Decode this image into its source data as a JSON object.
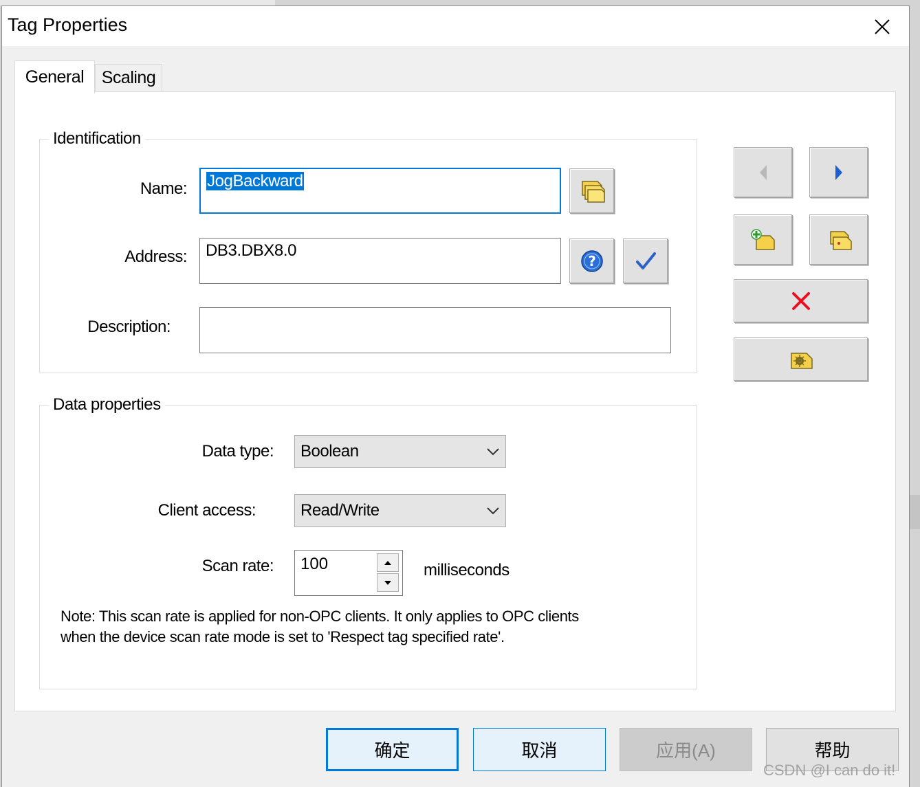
{
  "window": {
    "title": "Tag Properties"
  },
  "tabs": [
    {
      "label": "General",
      "active": true
    },
    {
      "label": "Scaling",
      "active": false
    }
  ],
  "identification": {
    "group_title": "Identification",
    "name_label": "Name:",
    "name_value": "JogBackward",
    "address_label": "Address:",
    "address_value": "DB3.DBX8.0",
    "description_label": "Description:",
    "description_value": ""
  },
  "data_properties": {
    "group_title": "Data properties",
    "data_type_label": "Data type:",
    "data_type_value": "Boolean",
    "client_access_label": "Client access:",
    "client_access_value": "Read/Write",
    "scan_rate_label": "Scan rate:",
    "scan_rate_value": "100",
    "scan_rate_unit": "milliseconds",
    "note_line1": "Note: This scan rate is applied for non-OPC clients. It only applies to OPC clients",
    "note_line2": "when the device scan rate mode is set to 'Respect tag specified rate'."
  },
  "side_buttons": {
    "icons": [
      "previous-tag-icon",
      "next-tag-icon",
      "new-tag-icon",
      "duplicate-tag-icon",
      "delete-tag-icon",
      "auto-generate-tag-icon"
    ]
  },
  "footer": {
    "ok_label": "确定",
    "cancel_label": "取消",
    "apply_label": "应用(A)",
    "help_label": "帮助"
  },
  "watermark": "CSDN @I can do it!",
  "colors": {
    "accent": "#0078d7",
    "selection": "#0078d7",
    "delete_red": "#e81123",
    "tag_yellow": "#f5d04a"
  }
}
